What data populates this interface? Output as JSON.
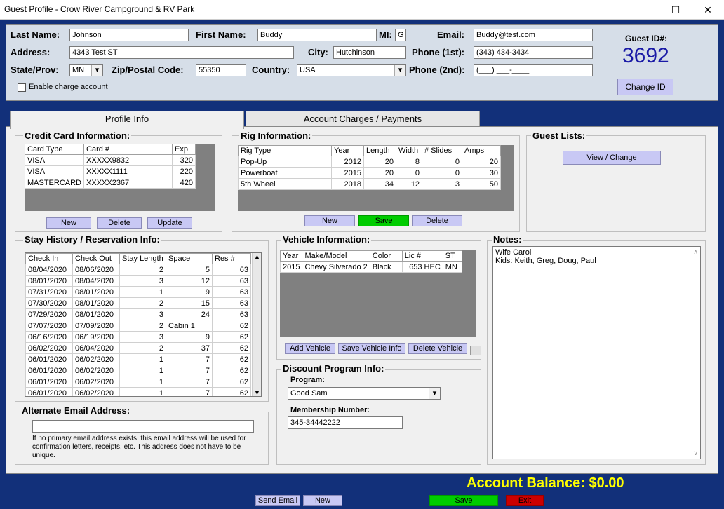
{
  "window": {
    "title": "Guest Profile - Crow River Campground & RV Park",
    "minimize": "—",
    "maximize": "☐",
    "close": "✕"
  },
  "guest": {
    "last_name_label": "Last Name:",
    "last_name": "Johnson",
    "first_name_label": "First Name:",
    "first_name": "Buddy",
    "mi_label": "MI:",
    "mi": "G",
    "email_label": "Email:",
    "email": "Buddy@test.com",
    "address_label": "Address:",
    "address": "4343 Test ST",
    "city_label": "City:",
    "city": "Hutchinson",
    "phone1_label": "Phone (1st):",
    "phone1": "(343) 434-3434",
    "state_label": "State/Prov:",
    "state": "MN",
    "zip_label": "Zip/Postal Code:",
    "zip": "55350",
    "country_label": "Country:",
    "country": "USA",
    "phone2_label": "Phone (2nd):",
    "phone2": "(___) ___-____",
    "charge_label": "Enable charge account",
    "guest_id_label": "Guest ID#:",
    "guest_id": "3692",
    "change_id": "Change ID"
  },
  "tabs": {
    "profile": "Profile Info",
    "charges": "Account Charges / Payments"
  },
  "credit": {
    "title": "Credit Card Information:",
    "headers": [
      "Card Type",
      "Card #",
      "Exp"
    ],
    "rows": [
      [
        "VISA",
        "XXXXX9832",
        "320"
      ],
      [
        "VISA",
        "XXXXX1111",
        "220"
      ],
      [
        "MASTERCARD",
        "XXXXX2367",
        "420"
      ]
    ],
    "new": "New",
    "delete": "Delete",
    "update": "Update"
  },
  "rig": {
    "title": "Rig Information:",
    "headers": [
      "Rig Type",
      "Year",
      "Length",
      "Width",
      "# Slides",
      "Amps"
    ],
    "rows": [
      [
        "Pop-Up",
        "2012",
        "20",
        "8",
        "0",
        "20"
      ],
      [
        "Powerboat",
        "2015",
        "20",
        "0",
        "0",
        "30"
      ],
      [
        "5th Wheel",
        "2018",
        "34",
        "12",
        "3",
        "50"
      ]
    ],
    "new": "New",
    "save": "Save",
    "delete": "Delete"
  },
  "guest_lists": {
    "title": "Guest Lists:",
    "view": "View / Change"
  },
  "stay": {
    "title": "Stay History / Reservation Info:",
    "headers": [
      "Check In",
      "Check Out",
      "Stay Length",
      "Space",
      "Res #"
    ],
    "rows": [
      [
        "08/04/2020",
        "08/06/2020",
        "2",
        "5",
        "63"
      ],
      [
        "08/01/2020",
        "08/04/2020",
        "3",
        "12",
        "63"
      ],
      [
        "07/31/2020",
        "08/01/2020",
        "1",
        "9",
        "63"
      ],
      [
        "07/30/2020",
        "08/01/2020",
        "2",
        "15",
        "63"
      ],
      [
        "07/29/2020",
        "08/01/2020",
        "3",
        "24",
        "63"
      ],
      [
        "07/07/2020",
        "07/09/2020",
        "2",
        "Cabin 1",
        "62"
      ],
      [
        "06/16/2020",
        "06/19/2020",
        "3",
        "9",
        "62"
      ],
      [
        "06/02/2020",
        "06/04/2020",
        "2",
        "37",
        "62"
      ],
      [
        "06/01/2020",
        "06/02/2020",
        "1",
        "7",
        "62"
      ],
      [
        "06/01/2020",
        "06/02/2020",
        "1",
        "7",
        "62"
      ],
      [
        "06/01/2020",
        "06/02/2020",
        "1",
        "7",
        "62"
      ],
      [
        "06/01/2020",
        "06/02/2020",
        "1",
        "7",
        "62"
      ]
    ]
  },
  "vehicle": {
    "title": "Vehicle Information:",
    "headers": [
      "Year",
      "Make/Model",
      "Color",
      "Lic #",
      "ST"
    ],
    "rows": [
      [
        "2015",
        "Chevy Silverado 2",
        "Black",
        "653 HEC",
        "MN"
      ]
    ],
    "add": "Add Vehicle",
    "save": "Save Vehicle Info",
    "delete": "Delete Vehicle"
  },
  "notes": {
    "title": "Notes:",
    "line1": "Wife Carol",
    "line2": "Kids:  Keith, Greg, Doug, Paul"
  },
  "alt_email": {
    "title": "Alternate Email Address:",
    "value": "",
    "help": "If no primary email address exists, this email address will be used for confirmation letters, receipts, etc.  This address does not have to be unique."
  },
  "discount": {
    "title": "Discount Program Info:",
    "program_label": "Program:",
    "program": "Good Sam",
    "membership_label": "Membership Number:",
    "membership": "345-34442222"
  },
  "balance": {
    "text": "Account Balance:  $0.00"
  },
  "footer": {
    "send_email": "Send Email",
    "new": "New",
    "save": "Save",
    "exit": "Exit"
  },
  "colors": {
    "save_green": "#00cc00",
    "exit_red": "#cc0000",
    "balance_yellow": "#ffff00",
    "id_blue": "#1a1aa6",
    "background": "#12307a"
  }
}
